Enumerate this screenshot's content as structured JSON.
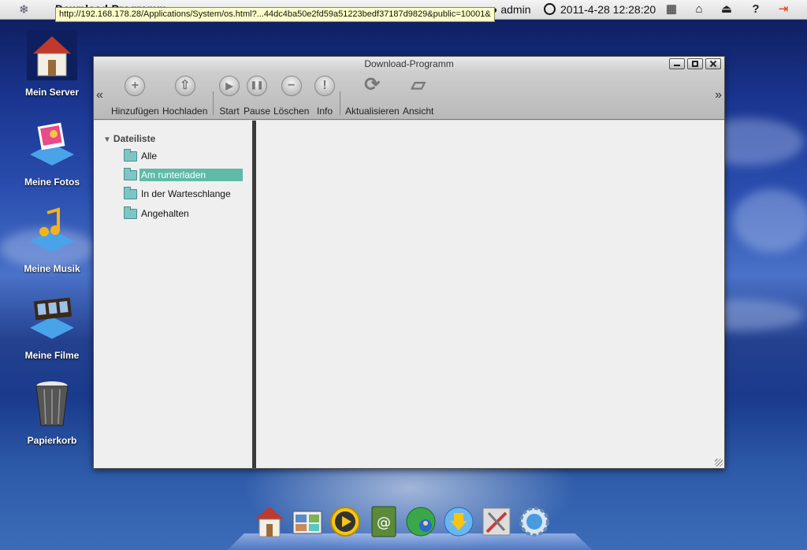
{
  "topbar": {
    "app_title": "Download-Programm",
    "user": "admin",
    "datetime": "2011-4-28 12:28:20",
    "url_tooltip": "http://192.168.178.28/Applications/System/os.html?...44dc4ba50e2fd59a51223bedf37187d9829&public=10001&",
    "icons": [
      "snowflake-logo-icon",
      "clock-icon",
      "grid-icon",
      "network-icon",
      "eject-icon",
      "help-icon",
      "logout-icon"
    ]
  },
  "desktop": {
    "icons": [
      {
        "label": "Mein Server",
        "icon": "house-icon"
      },
      {
        "label": "Meine Fotos",
        "icon": "photos-icon"
      },
      {
        "label": "Meine Musik",
        "icon": "music-icon"
      },
      {
        "label": "Meine Filme",
        "icon": "film-icon"
      },
      {
        "label": "Papierkorb",
        "icon": "trash-icon"
      }
    ]
  },
  "window": {
    "title": "Download-Programm",
    "toolbar": [
      {
        "label": "Hinzufügen",
        "icon": "plus-icon",
        "glyph": "+"
      },
      {
        "label": "Hochladen",
        "icon": "upload-icon",
        "glyph": "⇧"
      },
      {
        "label": "Start",
        "icon": "play-icon",
        "glyph": "▶"
      },
      {
        "label": "Pause",
        "icon": "pause-icon",
        "glyph": "❚❚"
      },
      {
        "label": "Löschen",
        "icon": "minus-icon",
        "glyph": "−"
      },
      {
        "label": "Info",
        "icon": "info-icon",
        "glyph": "!"
      },
      {
        "label": "Aktualisieren",
        "icon": "refresh-icon",
        "glyph": "⟳"
      },
      {
        "label": "Ansicht",
        "icon": "folder-open-icon",
        "glyph": "▱"
      }
    ],
    "tree": {
      "root": "Dateiliste",
      "items": [
        "Alle",
        "Am runterladen",
        "In der Warteschlange",
        "Angehalten"
      ],
      "selected": "Am runterladen"
    }
  },
  "colors": {
    "selection": "#5fbaa8",
    "folder": "#7ec5c6",
    "tooltip_bg": "#ffffc8"
  },
  "dock": {
    "items": [
      "home-icon",
      "gallery-icon",
      "media-player-icon",
      "address-book-icon",
      "globe-user-icon",
      "download-icon",
      "tools-icon",
      "settings-gear-icon"
    ]
  }
}
